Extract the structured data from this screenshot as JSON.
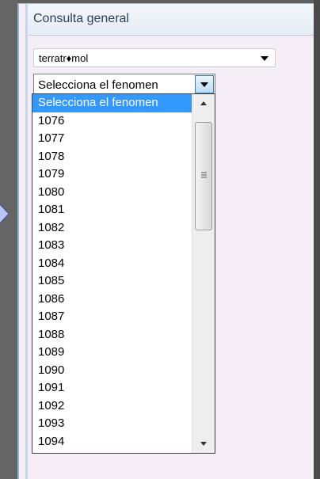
{
  "panel": {
    "title": "Consulta general"
  },
  "filter_combo": {
    "value": "terratr♦mol"
  },
  "phenomenon_combo": {
    "value": "Selecciona el fenomen"
  },
  "dropdown": {
    "options": [
      "Selecciona el fenomen",
      "1076",
      "1077",
      "1078",
      "1079",
      "1080",
      "1081",
      "1082",
      "1083",
      "1084",
      "1085",
      "1086",
      "1087",
      "1088",
      "1089",
      "1090",
      "1091",
      "1092",
      "1093",
      "1094"
    ],
    "selected_index": 0,
    "scroll_position": 0.0
  },
  "colors": {
    "selection": "#3399ff",
    "panel_background": "#f6eef7",
    "frame": "#5f5f5f"
  }
}
